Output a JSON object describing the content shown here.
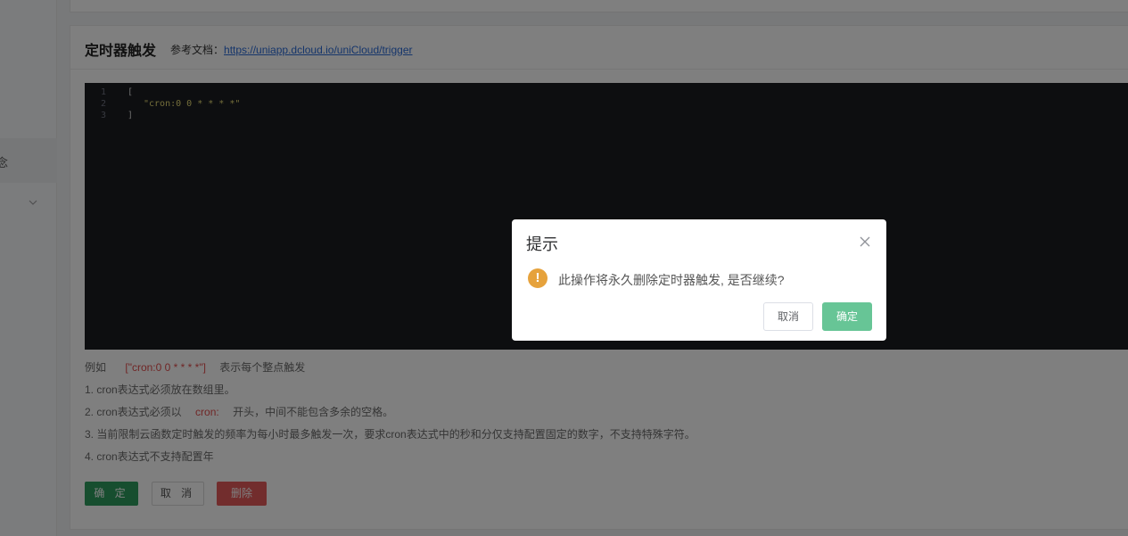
{
  "sidebar": {
    "item_label": "念"
  },
  "card": {
    "title": "定时器触发",
    "doc_label": "参考文档：",
    "doc_link": "https://uniapp.dcloud.io/uniCloud/trigger"
  },
  "editor": {
    "lines": [
      {
        "num": "1",
        "text": "["
      },
      {
        "num": "2",
        "text": "\"cron:0 0 * * * *\""
      },
      {
        "num": "3",
        "text": "]"
      }
    ]
  },
  "hints": {
    "example_prefix": "例如",
    "example_code": "[\"cron:0 0 * * * *\"]",
    "example_suffix": "表示每个整点触发",
    "rule1": "1. cron表达式必须放在数组里。",
    "rule2_prefix": "2. cron表达式必须以",
    "rule2_code": "cron:",
    "rule2_suffix": "开头，中间不能包含多余的空格。",
    "rule3": "3. 当前限制云函数定时触发的频率为每小时最多触发一次，要求cron表达式中的秒和分仅支持配置固定的数字，不支持特殊字符。",
    "rule4": "4. cron表达式不支持配置年"
  },
  "actions": {
    "ok_label": "确 定",
    "cancel_label": "取 消",
    "delete_label": "删除"
  },
  "dialog": {
    "title": "提示",
    "message": "此操作将永久删除定时器触发, 是否继续?",
    "warn_glyph": "!",
    "cancel_label": "取消",
    "confirm_label": "确定"
  }
}
